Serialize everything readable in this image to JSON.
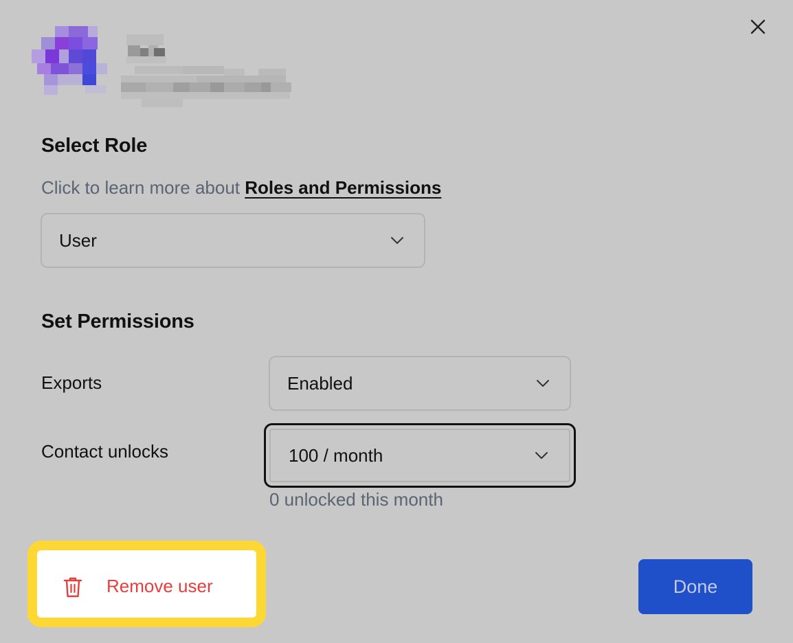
{
  "dialog": {
    "close_icon": "close-icon"
  },
  "role_section": {
    "title": "Select Role",
    "hint_prefix": "Click to learn more about ",
    "hint_link": "Roles and Permissions",
    "selected_role": "User"
  },
  "permissions_section": {
    "title": "Set Permissions",
    "exports": {
      "label": "Exports",
      "value": "Enabled"
    },
    "contact_unlocks": {
      "label": "Contact unlocks",
      "value": "100 / month",
      "note": "0 unlocked this month"
    }
  },
  "actions": {
    "remove_label": "Remove user",
    "done_label": "Done"
  },
  "colors": {
    "danger": "#e53e3e",
    "primary": "#1f4fc9",
    "highlight": "#fdd835"
  }
}
